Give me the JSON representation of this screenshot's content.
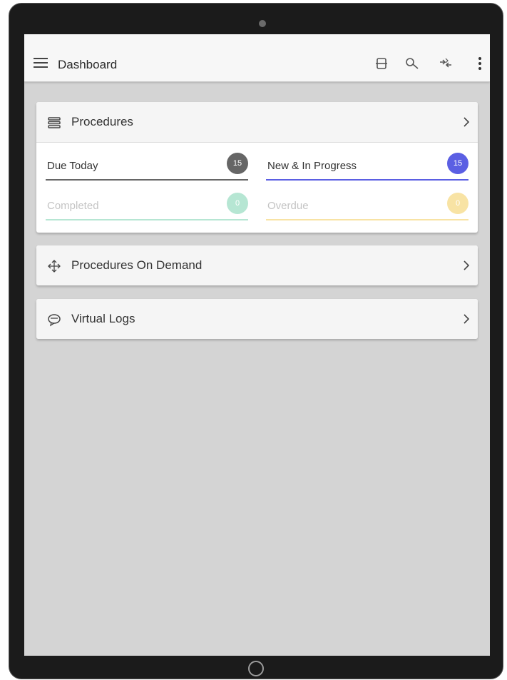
{
  "app_bar": {
    "title": "Dashboard",
    "icons": [
      "menu-icon",
      "sync-icon",
      "search-icon",
      "navigation-icon",
      "more-vertical-icon"
    ]
  },
  "procedures_card": {
    "title": "Procedures",
    "stats": [
      {
        "label": "Due Today",
        "count": "15",
        "color": "#666666",
        "label_color": "#333333"
      },
      {
        "label": "New & In Progress",
        "count": "15",
        "color": "#5b5fe3",
        "label_color": "#333333"
      },
      {
        "label": "Completed",
        "count": "0",
        "color": "#b6e6d3",
        "label_color": "#c4c4c4"
      },
      {
        "label": "Overdue",
        "count": "0",
        "color": "#f8e3a4",
        "label_color": "#c4c4c4"
      }
    ]
  },
  "on_demand_card": {
    "title": "Procedures On Demand"
  },
  "virtual_logs_card": {
    "title": "Virtual Logs"
  }
}
